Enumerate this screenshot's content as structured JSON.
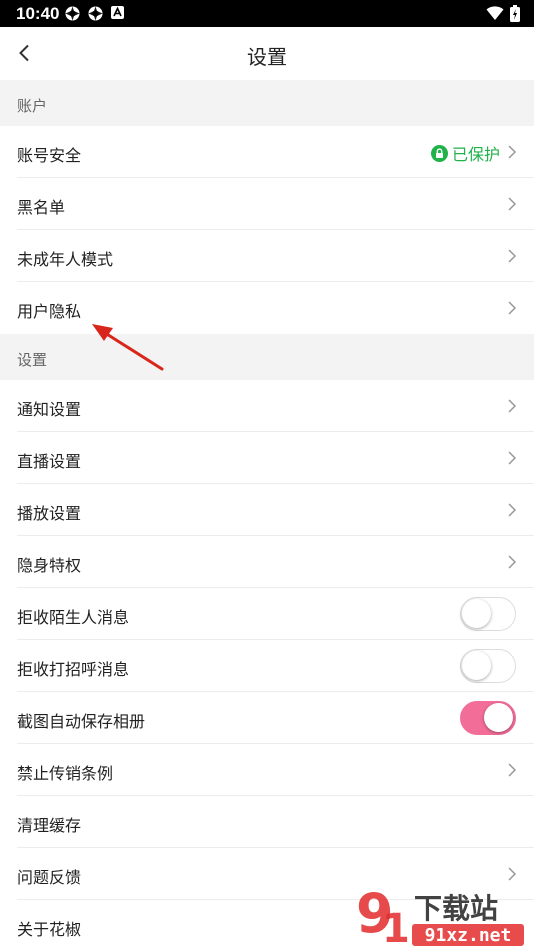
{
  "status_bar": {
    "time": "10:40",
    "icons_left": [
      "vpn-icon",
      "vpn-icon",
      "notification-a-icon"
    ],
    "icons_right": [
      "wifi-icon",
      "battery-icon"
    ]
  },
  "header": {
    "title": "设置"
  },
  "sections": [
    {
      "title": "账户",
      "rows": [
        {
          "label": "账号安全",
          "status": "已保护",
          "type": "link"
        },
        {
          "label": "黑名单",
          "type": "link"
        },
        {
          "label": "未成年人模式",
          "type": "link"
        },
        {
          "label": "用户隐私",
          "type": "link"
        }
      ]
    },
    {
      "title": "设置",
      "rows": [
        {
          "label": "通知设置",
          "type": "link"
        },
        {
          "label": "直播设置",
          "type": "link"
        },
        {
          "label": "播放设置",
          "type": "link"
        },
        {
          "label": "隐身特权",
          "type": "link"
        },
        {
          "label": "拒收陌生人消息",
          "type": "toggle",
          "on": false
        },
        {
          "label": "拒收打招呼消息",
          "type": "toggle",
          "on": false
        },
        {
          "label": "截图自动保存相册",
          "type": "toggle",
          "on": true
        },
        {
          "label": "禁止传销条例",
          "type": "link"
        },
        {
          "label": "清理缓存",
          "type": "plain"
        },
        {
          "label": "问题反馈",
          "type": "link"
        },
        {
          "label": "关于花椒",
          "type": "plain"
        }
      ]
    }
  ],
  "colors": {
    "accent_pink": "#f36d99",
    "protect_green": "#1fb34a",
    "annotation_red": "#d9261c"
  },
  "watermark": {
    "brand": "下载站",
    "domain": "91xz.net"
  }
}
